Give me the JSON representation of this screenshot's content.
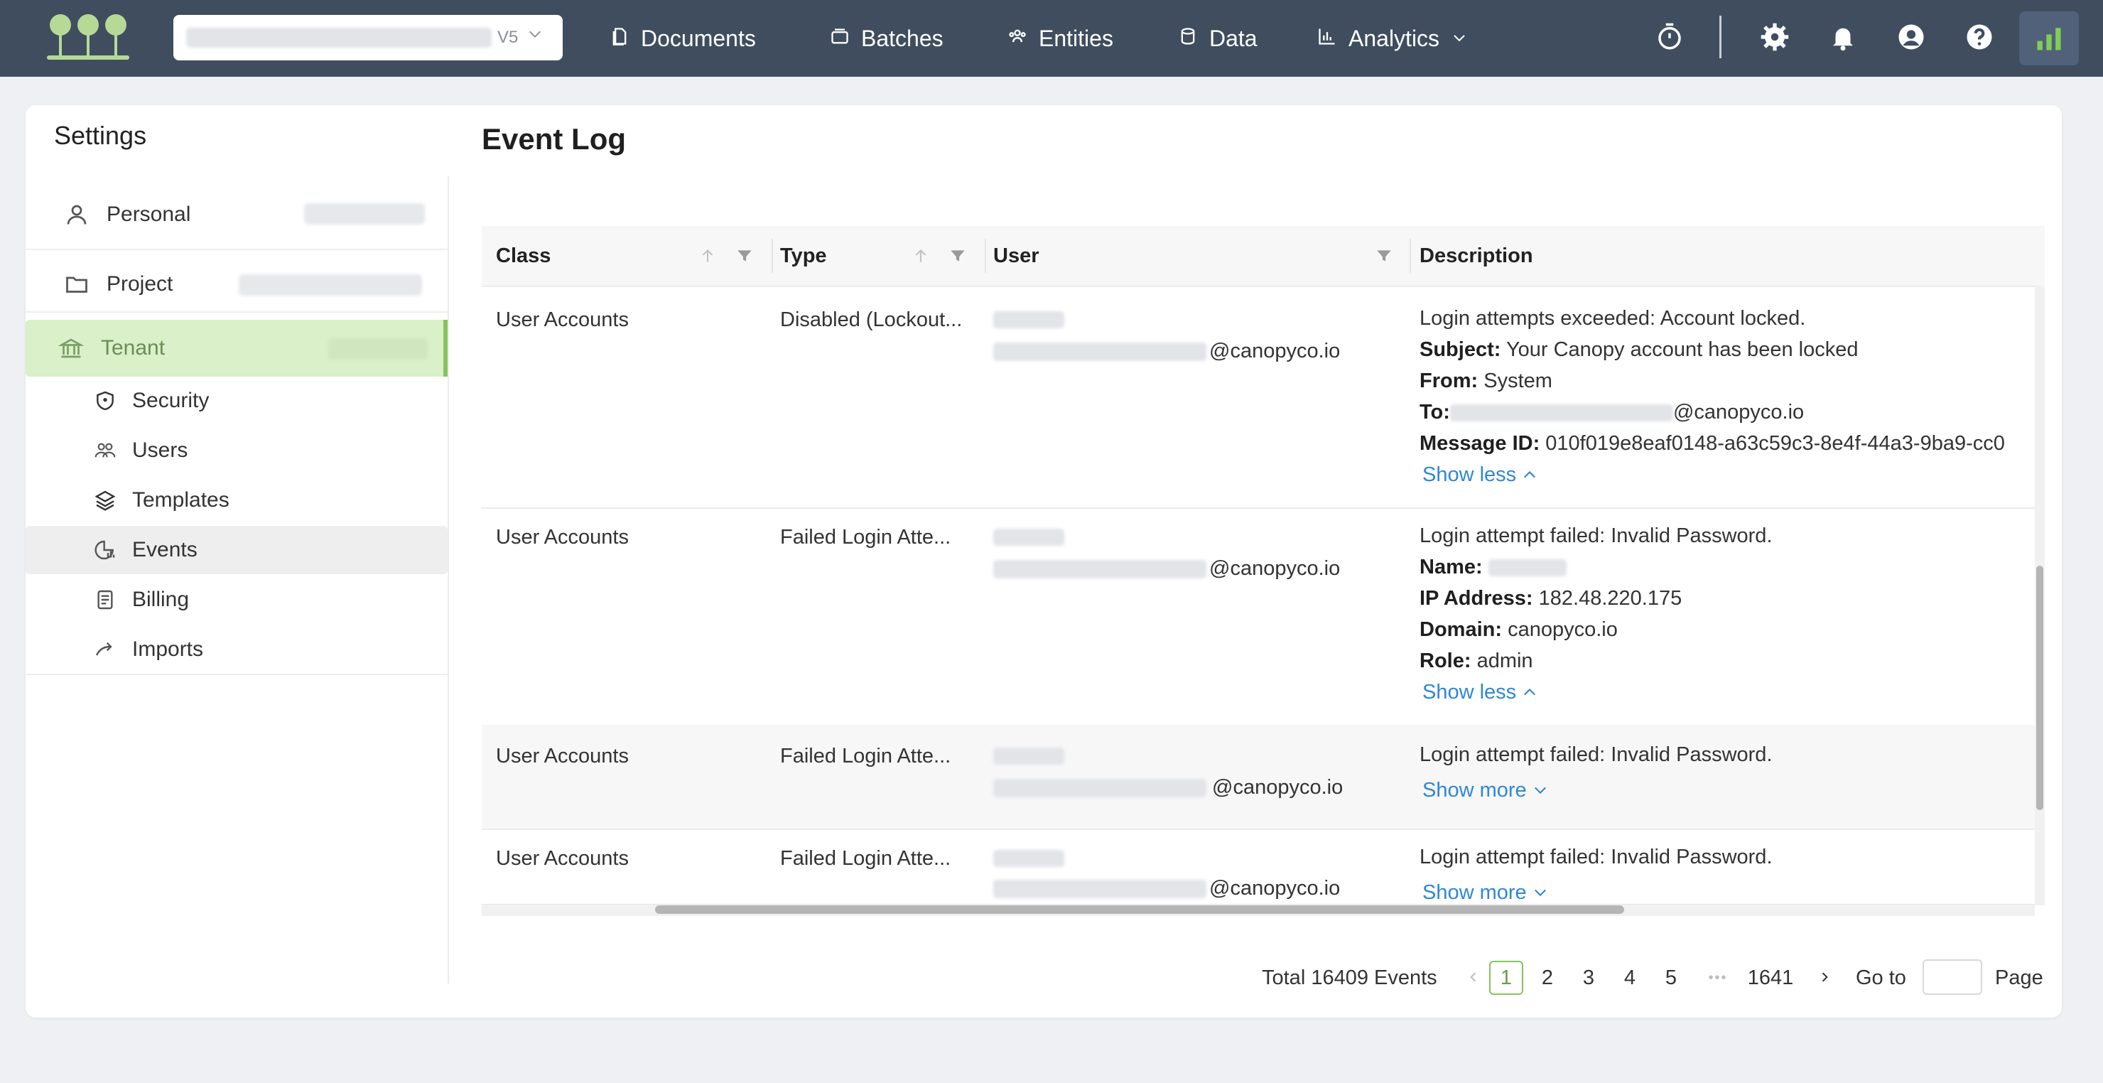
{
  "topbar": {
    "project_version": "V5",
    "nav": [
      {
        "label": "Documents",
        "icon": "documents-icon"
      },
      {
        "label": "Batches",
        "icon": "batches-icon"
      },
      {
        "label": "Entities",
        "icon": "entities-icon"
      },
      {
        "label": "Data",
        "icon": "data-icon"
      },
      {
        "label": "Analytics",
        "icon": "analytics-icon"
      }
    ],
    "colors": {
      "bar": "#3f4d5f",
      "logo": "#b6d995",
      "accent": "#86c45d"
    }
  },
  "sidebar": {
    "title": "Settings",
    "personal": "Personal",
    "project": "Project",
    "tenant": "Tenant",
    "sub_items": [
      "Security",
      "Users",
      "Templates",
      "Events",
      "Billing",
      "Imports"
    ],
    "active": "Events"
  },
  "main": {
    "title": "Event Log",
    "columns": [
      "Class",
      "Type",
      "User",
      "Description"
    ],
    "rows": [
      {
        "class": "User Accounts",
        "type": "Disabled (Lockout...",
        "user_email_suffix": "@canopyco.io",
        "desc_line": "Login attempts exceeded: Account locked.",
        "details": [
          {
            "label": "Subject:",
            "value": "Your Canopy account has been locked"
          },
          {
            "label": "From:",
            "value": "System"
          },
          {
            "label": "To:",
            "value": "@canopyco.io"
          },
          {
            "label": "Message ID:",
            "value": "010f019e8eaf0148-a63c59c3-8e4f-44a3-9ba9-cc0"
          }
        ],
        "toggle": "Show less"
      },
      {
        "class": "User Accounts",
        "type": "Failed Login Atte...",
        "user_email_suffix": "@canopyco.io",
        "desc_line": "Login attempt failed: Invalid Password.",
        "details": [
          {
            "label": "Name:",
            "value": ""
          },
          {
            "label": "IP Address:",
            "value": "182.48.220.175"
          },
          {
            "label": "Domain:",
            "value": "canopyco.io"
          },
          {
            "label": "Role:",
            "value": "admin"
          }
        ],
        "toggle": "Show less"
      },
      {
        "class": "User Accounts",
        "type": "Failed Login Atte...",
        "user_email_suffix": "@canopyco.io",
        "desc_line": "Login attempt failed: Invalid Password.",
        "toggle": "Show more"
      },
      {
        "class": "User Accounts",
        "type": "Failed Login Atte...",
        "user_email_suffix": "@canopyco.io",
        "desc_line": "Login attempt failed: Invalid Password.",
        "toggle": "Show more"
      }
    ]
  },
  "pagination": {
    "total": "Total 16409 Events",
    "pages": [
      "1",
      "2",
      "3",
      "4",
      "5"
    ],
    "ellipsis": "•••",
    "last_page": "1641",
    "current": "1",
    "goto_label": "Go to",
    "page_label": "Page",
    "goto_value": ""
  }
}
